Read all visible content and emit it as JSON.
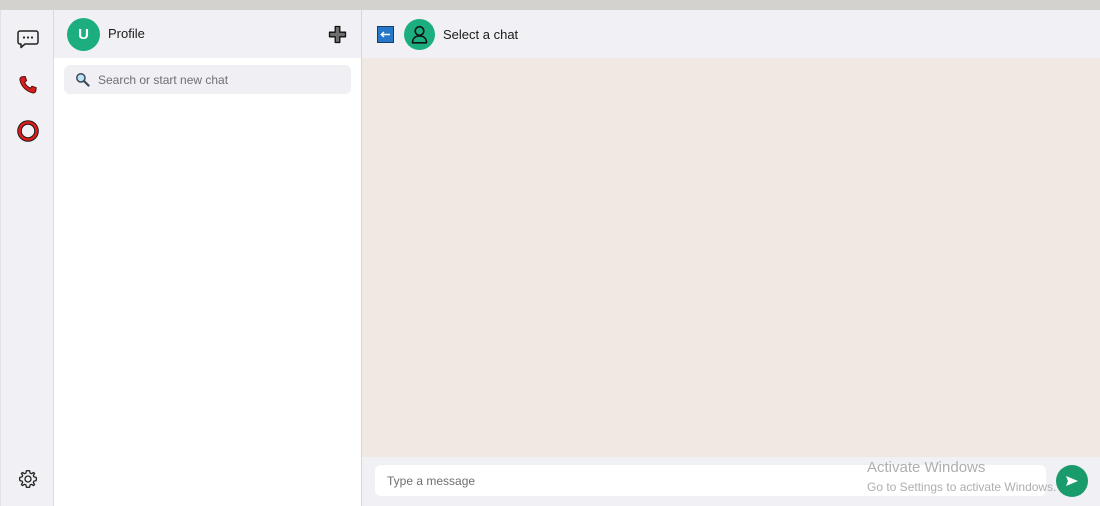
{
  "list": {
    "profile_initial": "U",
    "profile_label": "Profile",
    "search_placeholder": "Search or start new chat"
  },
  "chat": {
    "title": "Select a chat",
    "message_placeholder": "Type a message"
  },
  "rail": {
    "icons": [
      "chat-icon",
      "phone-icon",
      "status-icon",
      "settings-icon"
    ]
  },
  "watermark": {
    "title": "Activate Windows",
    "subtitle": "Go to Settings to activate Windows."
  },
  "colors": {
    "accent": "#1dae7f",
    "send": "#1a9b6c",
    "chat_bg": "#f0e8e2",
    "header_bg": "#f1f1f5"
  }
}
